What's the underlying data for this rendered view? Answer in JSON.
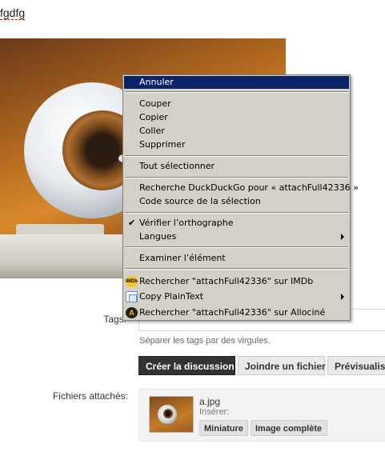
{
  "editor": {
    "text": "fgdfg"
  },
  "form": {
    "tags_label": "Tags:",
    "tags_hint": "Séparer les tags par des virgules.",
    "buttons": {
      "create": "Créer la discussion",
      "attach": "Joindre un fichier",
      "preview": "Prévisualiser"
    },
    "files_label": "Fichiers attachés:",
    "attachment": {
      "file_name": "a.jpg",
      "insert_label": "Insérer:",
      "thumbnail_button": "Miniature",
      "full_image_button": "Image complète"
    }
  },
  "context_menu": {
    "undo": "Annuler",
    "cut": "Couper",
    "copy": "Copier",
    "paste": "Coller",
    "delete": "Supprimer",
    "select_all": "Tout sélectionner",
    "search_ddg": "Recherche DuckDuckGo pour « attachFull42336 »",
    "view_source": "Code source de la sélection",
    "spellcheck": "Vérifier l’orthographe",
    "languages": "Langues",
    "inspect": "Examiner l’élément",
    "search_imdb": "Rechercher \"attachFull42336\" sur  IMDb",
    "copy_plaintext": "Copy PlainText",
    "search_allocine": "Rechercher \"attachFull42336\" sur  Allociné",
    "check_mark": "✔",
    "imdb_icon_text": "IMDb"
  },
  "icons": {
    "imdb": "imdb-icon",
    "copy_plaintext": "copy-plaintext-icon",
    "allocine": "allocine-icon"
  },
  "colors": {
    "menu_bg": "#d4d0c8",
    "menu_highlight": "#0a246a",
    "primary_button": "#333333"
  }
}
